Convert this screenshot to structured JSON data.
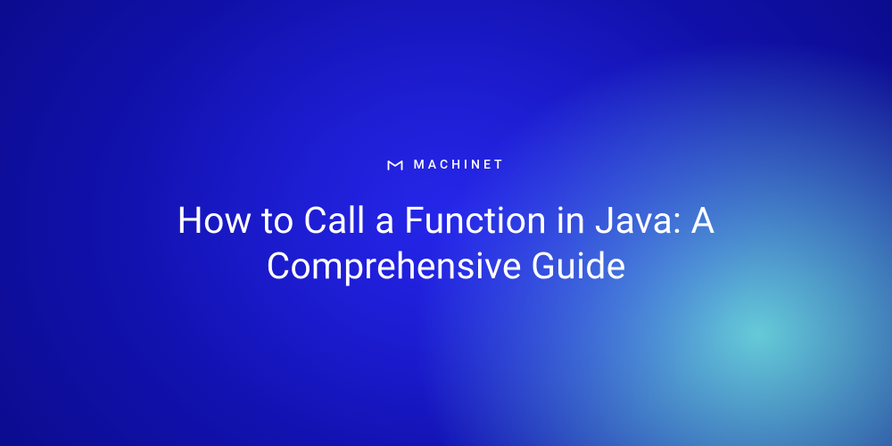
{
  "brand": {
    "name": "MACHINET",
    "icon": "machinet-logo"
  },
  "title": "How to Call a Function in Java: A Comprehensive Guide",
  "colors": {
    "text": "#ffffff",
    "gradient_start": "#1515c0",
    "gradient_mid": "#0a0a80",
    "gradient_accent": "#64dc96"
  }
}
